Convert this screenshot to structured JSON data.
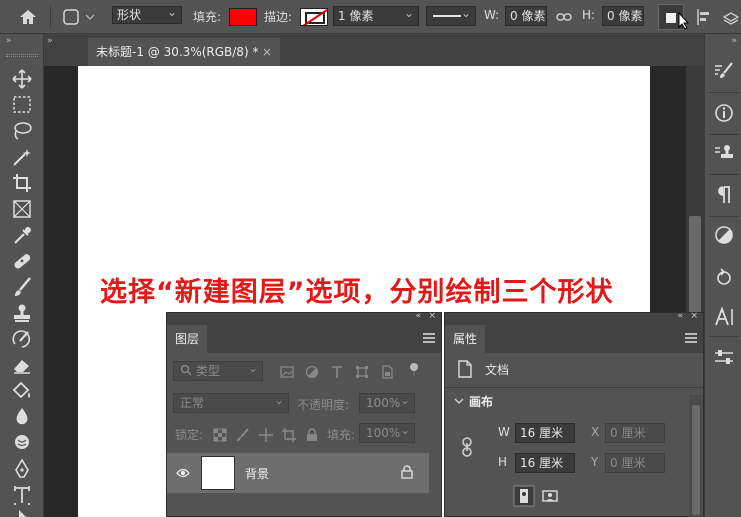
{
  "options_bar": {
    "shape_mode": "形状",
    "fill_label": "填充:",
    "fill_color": "#ff0000",
    "stroke_label": "描边:",
    "stroke_width": "1 像素",
    "width_label": "W:",
    "width_value": "0 像素",
    "height_label": "H:",
    "height_value": "0 像素"
  },
  "document": {
    "tab_title": "未标题-1 @ 30.3%(RGB/8) *",
    "tab_close": "×"
  },
  "caption": "选择“新建图层”选项，分别绘制三个形状",
  "layers_panel": {
    "tab": "图层",
    "filter_placeholder": "类型",
    "blend_mode": "正常",
    "opacity_label": "不透明度:",
    "opacity_value": "100%",
    "lock_label": "锁定:",
    "fill_label": "填充:",
    "fill_value": "100%",
    "layers": [
      {
        "name": "背景"
      }
    ]
  },
  "properties_panel": {
    "tab": "属性",
    "document_label": "文档",
    "section": "画布",
    "w_label": "W",
    "w_value": "16 厘米",
    "h_label": "H",
    "h_value": "16 厘米",
    "x_label": "X",
    "x_placeholder": "0 厘米",
    "y_label": "Y",
    "y_placeholder": "0 厘米"
  },
  "collapse_glyph": "»",
  "panel_collapse_glyph": "«",
  "panel_close_glyph": "×"
}
